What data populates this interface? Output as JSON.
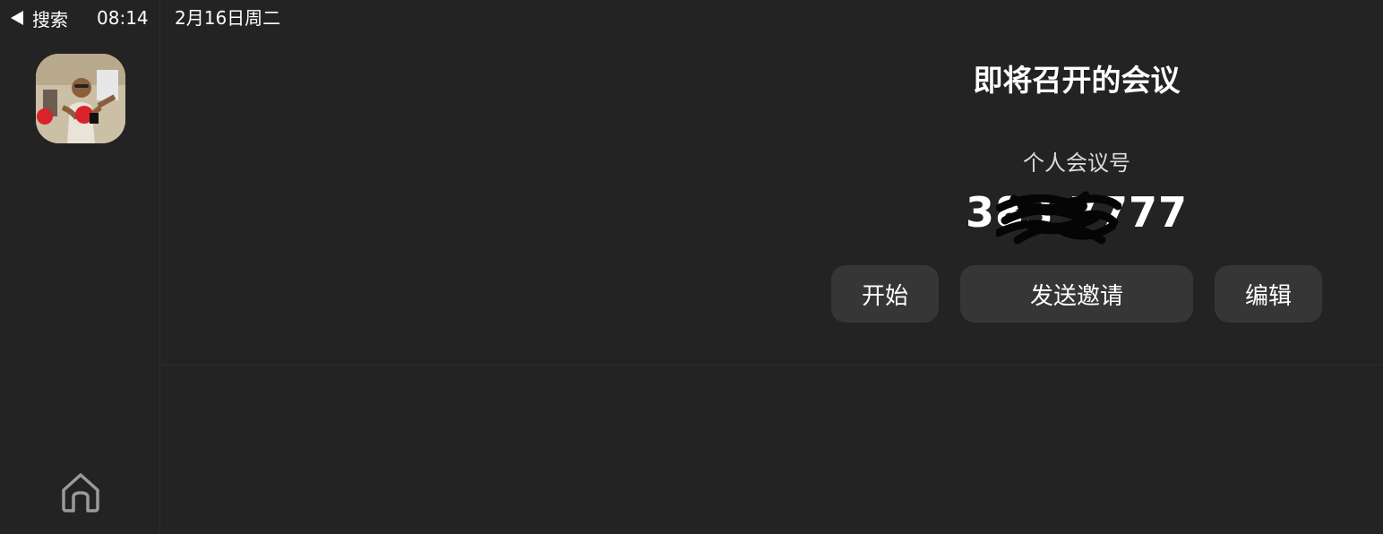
{
  "status_bar": {
    "back_label": "搜索",
    "time": "08:14",
    "date": "2月16日周二"
  },
  "sidebar": {
    "avatar_icon": "user-photo-icon",
    "home_icon": "home-icon"
  },
  "meetings": {
    "title": "即将召开的会议",
    "pmi_label": "个人会议号",
    "pmi_number": "383 7777",
    "buttons": {
      "start": "开始",
      "send_invite": "发送邀请",
      "edit": "编辑"
    }
  },
  "colors": {
    "background": "#232323",
    "button": "#363636",
    "text": "#ffffff"
  }
}
